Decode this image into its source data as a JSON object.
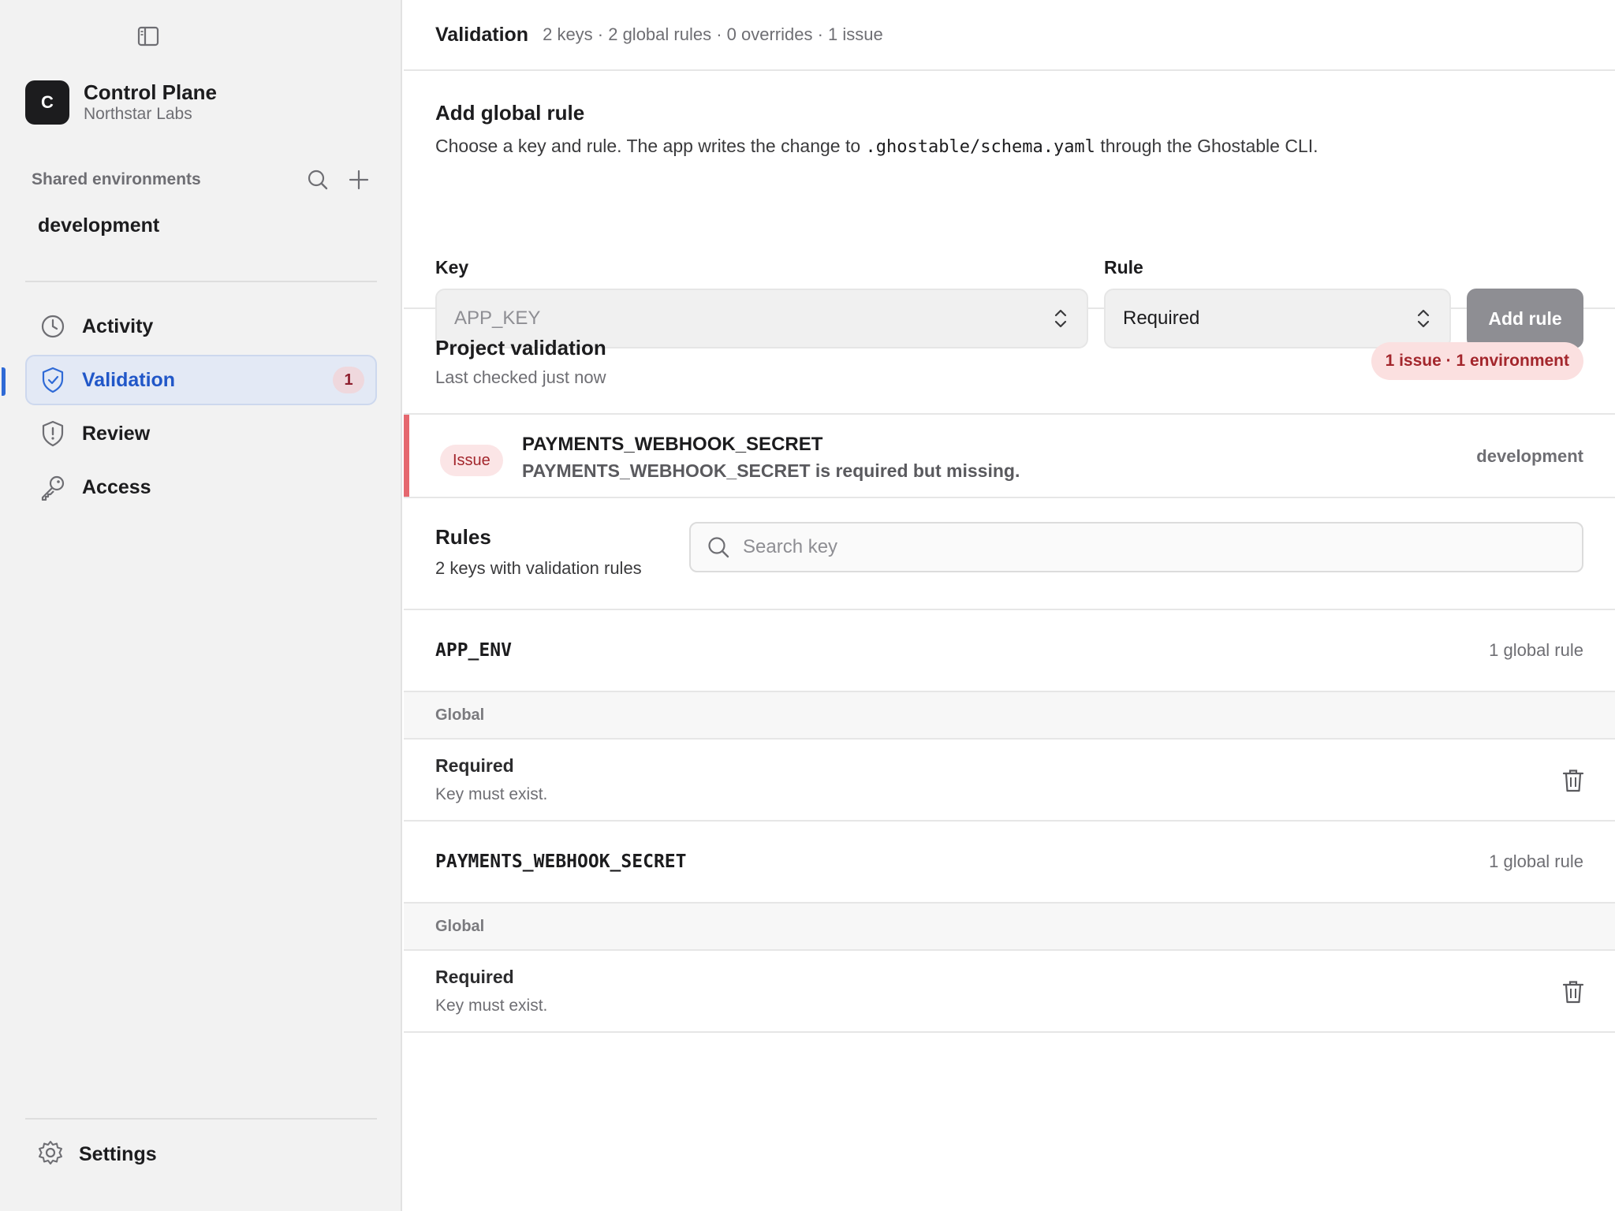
{
  "sidebar": {
    "app": {
      "avatar_letter": "C",
      "title": "Control Plane",
      "subtitle": "Northstar Labs"
    },
    "shared_label": "Shared environments",
    "environments": [
      "development"
    ],
    "nav": [
      {
        "label": "Activity",
        "icon": "clock-icon"
      },
      {
        "label": "Validation",
        "icon": "shield-check-icon",
        "badge": "1",
        "active": true
      },
      {
        "label": "Review",
        "icon": "shield-alert-icon"
      },
      {
        "label": "Access",
        "icon": "key-icon"
      }
    ],
    "settings_label": "Settings"
  },
  "header": {
    "title": "Validation",
    "meta": "2 keys · 2 global rules · 0 overrides · 1 issue"
  },
  "add_rule": {
    "title": "Add global rule",
    "desc_prefix": "Choose a key and rule. The app writes the change to ",
    "desc_path": ".ghostable/schema.yaml",
    "desc_suffix": " through the Ghostable CLI.",
    "key_label": "Key",
    "key_value": "APP_KEY",
    "rule_label": "Rule",
    "rule_value": "Required",
    "button": "Add rule"
  },
  "project_validation": {
    "title": "Project validation",
    "subtitle": "Last checked just now",
    "pill": "1 issue · 1 environment"
  },
  "issue": {
    "tag": "Issue",
    "key": "PAYMENTS_WEBHOOK_SECRET",
    "message": "PAYMENTS_WEBHOOK_SECRET is required but missing.",
    "environment": "development"
  },
  "rules": {
    "title": "Rules",
    "subtitle": "2 keys with validation rules",
    "search_placeholder": "Search key",
    "keys": [
      {
        "name": "APP_ENV",
        "count": "1 global rule",
        "scope": "Global",
        "rule": "Required",
        "rule_desc": "Key must exist."
      },
      {
        "name": "PAYMENTS_WEBHOOK_SECRET",
        "count": "1 global rule",
        "scope": "Global",
        "rule": "Required",
        "rule_desc": "Key must exist."
      }
    ]
  },
  "colors": {
    "accent": "#2f6ad6",
    "danger": "#a3262c",
    "issue_bar": "#e5686f"
  }
}
